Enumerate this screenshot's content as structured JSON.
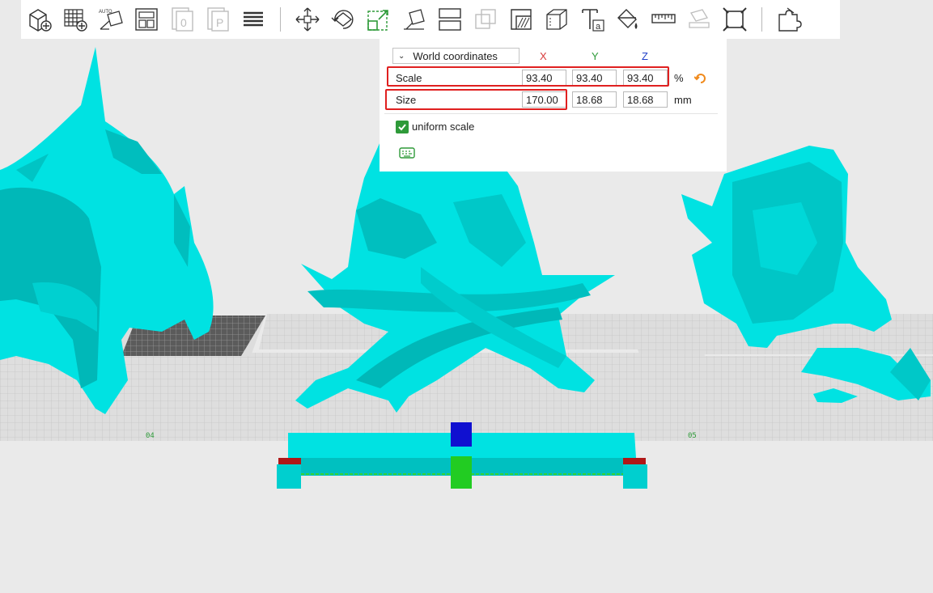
{
  "toolbar": {
    "items": [
      {
        "name": "add-cube-icon"
      },
      {
        "name": "add-plate-icon"
      },
      {
        "name": "auto-arrange-icon",
        "label": "AUTO"
      },
      {
        "name": "layout-icon"
      },
      {
        "name": "object-0-icon",
        "label": "0"
      },
      {
        "name": "object-p-icon",
        "label": "P"
      },
      {
        "name": "layers-icon"
      },
      {
        "name": "move-icon"
      },
      {
        "name": "rotate-icon"
      },
      {
        "name": "scale-icon"
      },
      {
        "name": "place-face-icon"
      },
      {
        "name": "split-icon"
      },
      {
        "name": "boolean-icon"
      },
      {
        "name": "support-paint-icon"
      },
      {
        "name": "cut-icon"
      },
      {
        "name": "text-icon",
        "label": "a"
      },
      {
        "name": "paint-bucket-icon"
      },
      {
        "name": "measure-icon"
      },
      {
        "name": "assembly-icon"
      },
      {
        "name": "fit-view-icon"
      },
      {
        "name": "puzzle-icon"
      }
    ]
  },
  "scale_panel": {
    "coordinate_mode": "World coordinates",
    "axes": {
      "x": "X",
      "y": "Y",
      "z": "Z"
    },
    "scale": {
      "label": "Scale",
      "x": "93.40",
      "y": "93.40",
      "z": "93.40",
      "unit": "%"
    },
    "size": {
      "label": "Size",
      "x": "170.00",
      "y": "18.68",
      "z": "18.68",
      "unit": "mm"
    },
    "uniform_scale": {
      "label": "uniform scale",
      "checked": true
    }
  },
  "plates": {
    "label_left": "04",
    "label_right": "05"
  },
  "colors": {
    "model": "#00e2e2",
    "model_dark": "#00a8a8",
    "bed": "#d6d6d6",
    "grid": "#c2c2c2",
    "highlight": "#e02020",
    "check": "#2e9a39",
    "axis_x": "#d83b3b",
    "axis_y": "#2e9a39",
    "axis_z": "#2040c8"
  }
}
